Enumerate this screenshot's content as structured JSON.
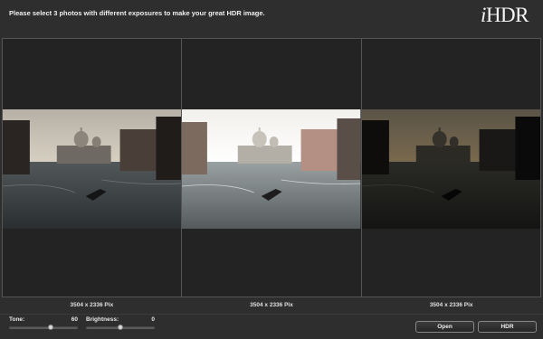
{
  "header": {
    "instruction": "Please select 3 photos with different exposures to make your great HDR image.",
    "logo_i": "i",
    "logo_rest": "HDR"
  },
  "photos": [
    {
      "dimensions": "3504 x 2336 Pix",
      "exposure": "normal"
    },
    {
      "dimensions": "3504 x 2336 Pix",
      "exposure": "over"
    },
    {
      "dimensions": "3504 x 2336 Pix",
      "exposure": "under"
    }
  ],
  "controls": {
    "tone": {
      "label": "Tone:",
      "value": "60",
      "level": 0.6
    },
    "brightness": {
      "label": "Brightness:",
      "value": "0",
      "level": 0.5
    }
  },
  "buttons": {
    "open": "Open",
    "hdr": "HDR"
  },
  "colors": {
    "background": "#2e2e2e",
    "panel": "#232323",
    "border": "#555555",
    "text": "#e8e8e8"
  }
}
